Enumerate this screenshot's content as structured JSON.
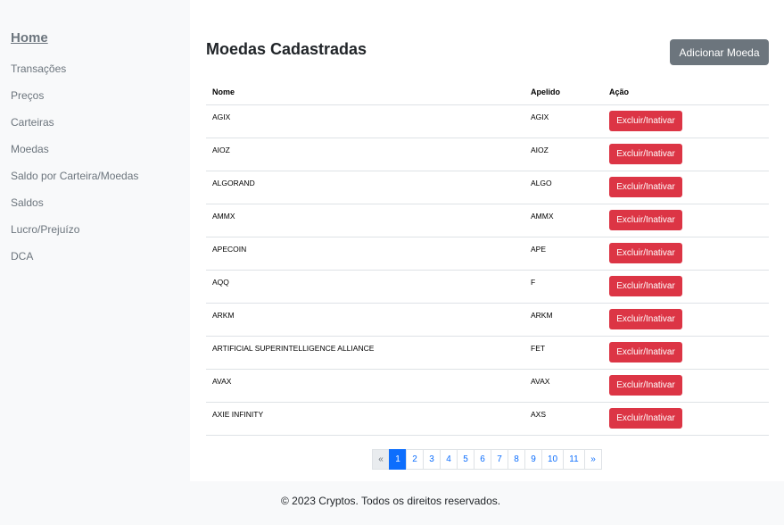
{
  "sidebar": {
    "home": "Home",
    "items": [
      {
        "label": "Transações"
      },
      {
        "label": "Preços"
      },
      {
        "label": "Carteiras"
      },
      {
        "label": "Moedas"
      },
      {
        "label": "Saldo por Carteira/Moedas"
      },
      {
        "label": "Saldos"
      },
      {
        "label": "Lucro/Prejuízo"
      },
      {
        "label": "DCA"
      }
    ]
  },
  "main": {
    "title": "Moedas Cadastradas",
    "add_button": "Adicionar Moeda",
    "table": {
      "headers": {
        "name": "Nome",
        "nickname": "Apelido",
        "action": "Ação"
      },
      "rows": [
        {
          "name": "AGIX",
          "nickname": "AGIX",
          "action": "Excluir/Inativar"
        },
        {
          "name": "AIOZ",
          "nickname": "AIOZ",
          "action": "Excluir/Inativar"
        },
        {
          "name": "ALGORAND",
          "nickname": "ALGO",
          "action": "Excluir/Inativar"
        },
        {
          "name": "AMMX",
          "nickname": "AMMX",
          "action": "Excluir/Inativar"
        },
        {
          "name": "APECOIN",
          "nickname": "APE",
          "action": "Excluir/Inativar"
        },
        {
          "name": "AQQ",
          "nickname": "F",
          "action": "Excluir/Inativar"
        },
        {
          "name": "ARKM",
          "nickname": "ARKM",
          "action": "Excluir/Inativar"
        },
        {
          "name": "ARTIFICIAL SUPERINTELLIGENCE ALLIANCE",
          "nickname": "FET",
          "action": "Excluir/Inativar"
        },
        {
          "name": "AVAX",
          "nickname": "AVAX",
          "action": "Excluir/Inativar"
        },
        {
          "name": "AXIE INFINITY",
          "nickname": "AXS",
          "action": "Excluir/Inativar"
        }
      ]
    },
    "pagination": {
      "prev": "«",
      "pages": [
        "1",
        "2",
        "3",
        "4",
        "5",
        "6",
        "7",
        "8",
        "9",
        "10",
        "11"
      ],
      "active": "1",
      "next": "»"
    }
  },
  "footer": {
    "text": "© 2023 Cryptos. Todos os direitos reservados."
  },
  "colors": {
    "primary": "#0d6efd",
    "danger": "#dc3545",
    "secondary": "#6c757d"
  }
}
